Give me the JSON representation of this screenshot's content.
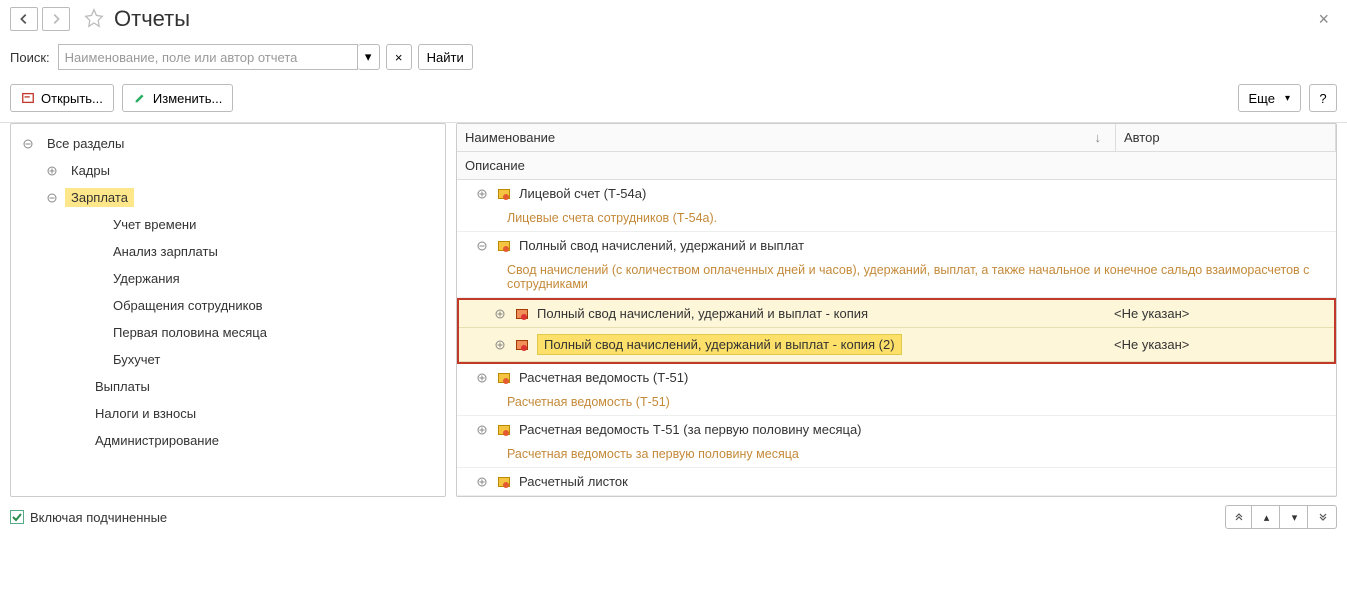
{
  "title": "Отчеты",
  "search": {
    "label": "Поиск:",
    "placeholder": "Наименование, поле или автор отчета",
    "find_label": "Найти",
    "clear_label": "×"
  },
  "toolbar": {
    "open_label": "Открыть...",
    "edit_label": "Изменить...",
    "more_label": "Еще",
    "help_label": "?"
  },
  "tree": {
    "root": "Все разделы",
    "items": [
      {
        "label": "Кадры",
        "level": 1,
        "expandable": true,
        "expanded": false
      },
      {
        "label": "Зарплата",
        "level": 1,
        "expandable": true,
        "expanded": true,
        "selected": true
      },
      {
        "label": "Учет времени",
        "level": 3,
        "expandable": false
      },
      {
        "label": "Анализ зарплаты",
        "level": 3,
        "expandable": false
      },
      {
        "label": "Удержания",
        "level": 3,
        "expandable": false
      },
      {
        "label": "Обращения сотрудников",
        "level": 3,
        "expandable": false
      },
      {
        "label": "Первая половина месяца",
        "level": 3,
        "expandable": false
      },
      {
        "label": "Бухучет",
        "level": 3,
        "expandable": false
      },
      {
        "label": "Выплаты",
        "level": 2,
        "expandable": false
      },
      {
        "label": "Налоги и взносы",
        "level": 2,
        "expandable": false
      },
      {
        "label": "Администрирование",
        "level": 2,
        "expandable": false
      }
    ]
  },
  "columns": {
    "name": "Наименование",
    "author": "Автор",
    "description": "Описание"
  },
  "reports": [
    {
      "title": "Лицевой счет (Т-54а)",
      "desc": "Лицевые счета сотрудников (Т-54а).",
      "author": "",
      "icon": "yellow",
      "expanded": false,
      "indent": 1
    },
    {
      "title": "Полный свод начислений, удержаний и выплат",
      "desc": "Свод начислений (с количеством оплаченных дней и часов), удержаний, выплат, а также начальное и конечное сальдо взаиморасчетов с сотрудниками",
      "author": "",
      "icon": "yellow",
      "expanded": true,
      "indent": 1
    },
    {
      "title": "Полный свод начислений, удержаний и выплат - копия",
      "desc": "",
      "author": "<Не указан>",
      "icon": "red",
      "expanded": false,
      "indent": 2,
      "highlight": true
    },
    {
      "title": "Полный свод начислений, удержаний и выплат - копия (2)",
      "desc": "",
      "author": "<Не указан>",
      "icon": "red",
      "expanded": false,
      "indent": 2,
      "highlight": true,
      "hl_title": true
    },
    {
      "title": "Расчетная ведомость (Т-51)",
      "desc": "Расчетная ведомость (Т-51)",
      "author": "",
      "icon": "yellow",
      "expanded": false,
      "indent": 1
    },
    {
      "title": "Расчетная ведомость Т-51 (за первую половину месяца)",
      "desc": "Расчетная ведомость за первую половину месяца",
      "author": "",
      "icon": "yellow",
      "expanded": false,
      "indent": 1
    },
    {
      "title": "Расчетный листок",
      "desc": "",
      "author": "",
      "icon": "yellow",
      "expanded": false,
      "indent": 1
    }
  ],
  "footer": {
    "checkbox_label": "Включая подчиненные",
    "checked": true
  }
}
